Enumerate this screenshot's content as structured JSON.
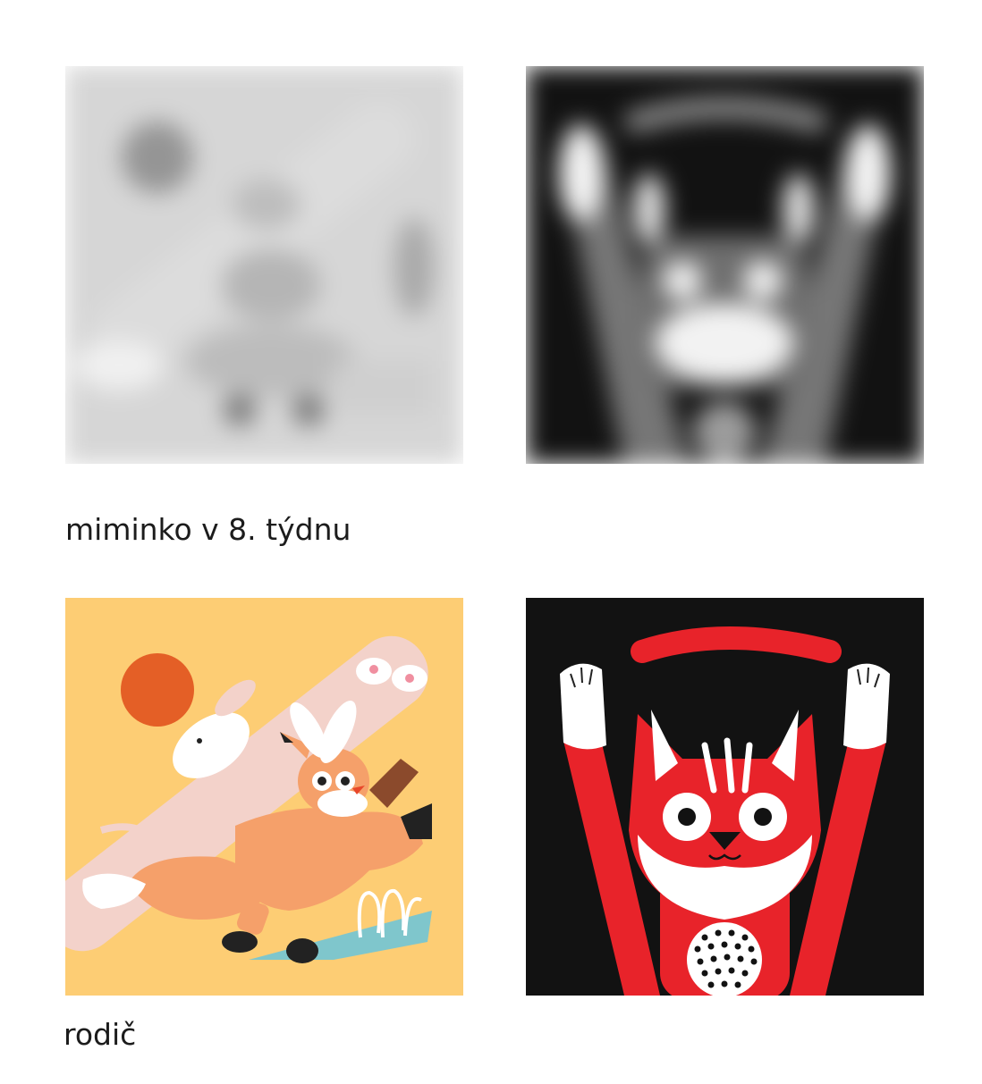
{
  "captions": {
    "baby_view": "miminko v 8. týdnu",
    "parent_view": "rodič"
  },
  "colors": {
    "color_background": "#fdcd74",
    "sun": "#e45f26",
    "fox": "#f5a06a",
    "bunny": "#f3d2ca",
    "water": "#7fc6cc",
    "card_black": "#121212",
    "cat_red": "#e8232a"
  },
  "illustrations": {
    "color_card": "bunny-fox-icon",
    "contrast_card": "cat-arms-up-icon"
  }
}
